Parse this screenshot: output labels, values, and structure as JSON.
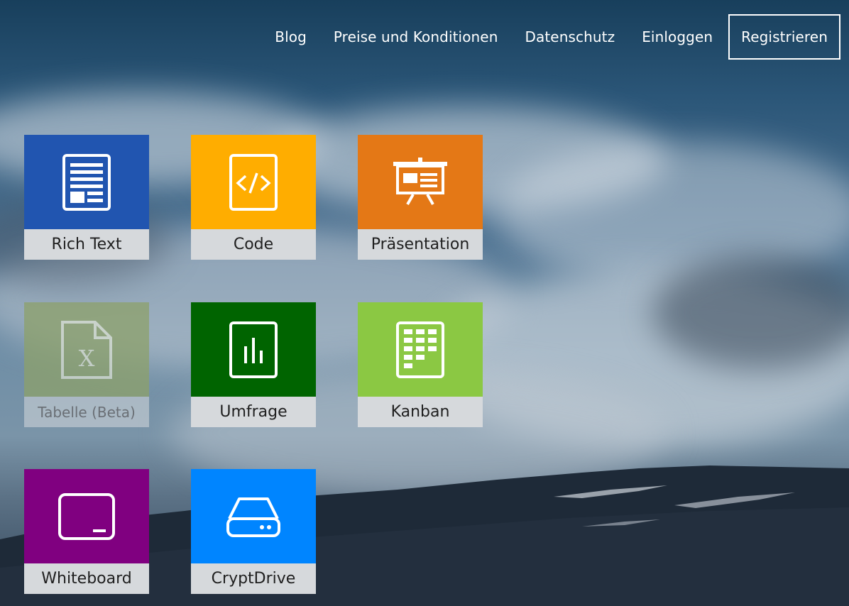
{
  "nav": {
    "blog": "Blog",
    "pricing": "Preise und Konditionen",
    "privacy": "Datenschutz",
    "login": "Einloggen",
    "register": "Registrieren"
  },
  "apps": [
    {
      "label": "Rich Text",
      "icon": "document-icon",
      "color": "#2155b0"
    },
    {
      "label": "Code",
      "icon": "code-icon",
      "color": "#ffad00"
    },
    {
      "label": "Präsentation",
      "icon": "presentation-icon",
      "color": "#e47816"
    },
    {
      "label": "Tabelle (Beta)",
      "icon": "spreadsheet-icon",
      "color": "#8da16a"
    },
    {
      "label": "Umfrage",
      "icon": "poll-icon",
      "color": "#006400"
    },
    {
      "label": "Kanban",
      "icon": "kanban-icon",
      "color": "#8bc843"
    },
    {
      "label": "Whiteboard",
      "icon": "whiteboard-icon",
      "color": "#800080"
    },
    {
      "label": "CryptDrive",
      "icon": "drive-icon",
      "color": "#0085ff"
    }
  ]
}
